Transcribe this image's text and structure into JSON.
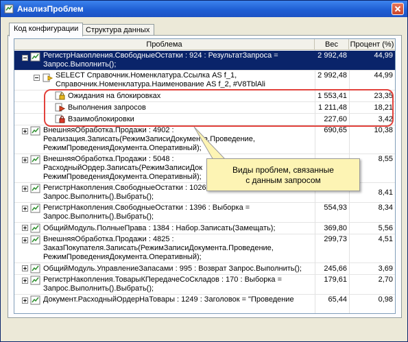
{
  "window": {
    "title": "АнализПроблем"
  },
  "tabs": [
    "Код конфигурации",
    "Структура данных"
  ],
  "columns": {
    "problem": "Проблема",
    "weight": "Вес",
    "percent": "Процент (%)"
  },
  "rows": [
    {
      "lines": [
        "РегистрНакопления.СвободныеОстатки : 924 : РезультатЗапроса =",
        "Запрос.Выполнить();"
      ],
      "weight": "2 992,48",
      "percent": "44,99"
    },
    {
      "lines": [
        "SELECT Справочник.Номенклатура.Ссылка AS f_1,",
        "Справочник.Номенклатура.Наименование AS f_2, #V8TblAli"
      ],
      "weight": "2 992,48",
      "percent": "44,99"
    },
    {
      "lines": [
        "Ожидания на блокировках"
      ],
      "weight": "1 553,41",
      "percent": "23,35"
    },
    {
      "lines": [
        "Выполнения запросов"
      ],
      "weight": "1 211,48",
      "percent": "18,21"
    },
    {
      "lines": [
        "Взаимоблокировки"
      ],
      "weight": "227,60",
      "percent": "3,42"
    },
    {
      "lines": [
        "ВнешняяОбработка.Продажи : 4902 :",
        "Реализация.Записать(РежимЗаписиДокумента.Проведение,",
        "РежимПроведенияДокумента.Оперативный);"
      ],
      "weight": "690,65",
      "percent": "10,38"
    },
    {
      "lines": [
        "ВнешняяОбработка.Продажи : 5048 :",
        "РасходныйОрдер.Записать(РежимЗаписиДок",
        "РежимПроведенияДокумента.Оперативный);"
      ],
      "weight": "",
      "percent": "8,55"
    },
    {
      "lines": [
        "РегистрНакопления.СвободныеОстатки : 1026",
        "Запрос.Выполнить().Выбрать();"
      ],
      "weight": "",
      "percent": "8,41"
    },
    {
      "lines": [
        "РегистрНакопления.СвободныеОстатки : 1396 : Выборка =",
        "Запрос.Выполнить().Выбрать();"
      ],
      "weight": "554,93",
      "percent": "8,34"
    },
    {
      "lines": [
        "ОбщийМодуль.ПолныеПрава : 1384 : Набор.Записать(Замещать);"
      ],
      "weight": "369,80",
      "percent": "5,56"
    },
    {
      "lines": [
        "ВнешняяОбработка.Продажи : 4825 :",
        "ЗаказПокупателя.Записать(РежимЗаписиДокумента.Проведение,",
        "РежимПроведенияДокумента.Оперативный);"
      ],
      "weight": "299,73",
      "percent": "4,51"
    },
    {
      "lines": [
        "ОбщийМодуль.УправлениеЗапасами : 995 : Возврат Запрос.Выполнить();"
      ],
      "weight": "245,66",
      "percent": "3,69"
    },
    {
      "lines": [
        "РегистрНакопления.ТоварыКПередачеСоСкладов : 170 : Выборка =",
        "Запрос.Выполнить().Выбрать();"
      ],
      "weight": "179,61",
      "percent": "2,70"
    },
    {
      "lines": [
        "Документ.РасходныйОрдерНаТовары : 1249 : Заголовок = \"Проведение"
      ],
      "weight": "65,44",
      "percent": "0,98"
    }
  ],
  "callout": {
    "line1": "Виды проблем, связанные",
    "line2": "с данным запросом"
  }
}
